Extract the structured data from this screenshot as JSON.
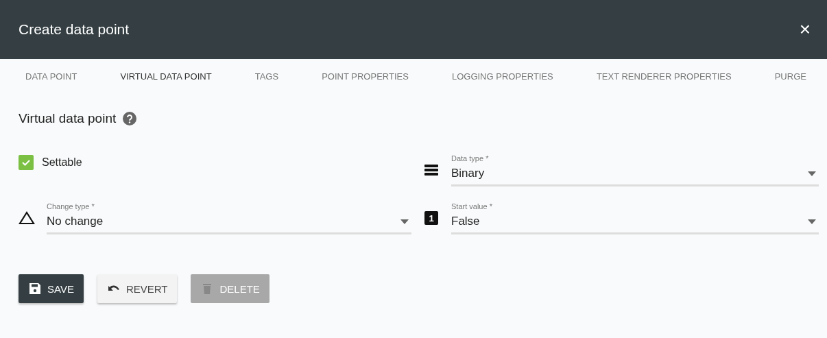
{
  "window": {
    "title": "Create data point",
    "close": "×"
  },
  "tabs": [
    {
      "label": "DATA POINT",
      "selected": false
    },
    {
      "label": "VIRTUAL DATA POINT",
      "selected": true
    },
    {
      "label": "TAGS",
      "selected": false
    },
    {
      "label": "POINT PROPERTIES",
      "selected": false
    },
    {
      "label": "LOGGING PROPERTIES",
      "selected": false
    },
    {
      "label": "TEXT RENDERER PROPERTIES",
      "selected": false
    },
    {
      "label": "PURGE",
      "selected": false
    }
  ],
  "section": {
    "title": "Virtual data point"
  },
  "settable": {
    "label": "Settable",
    "checked": true
  },
  "fields": [
    {
      "kind": "list",
      "label": "Data type *",
      "value": "Binary"
    },
    {
      "kind": "delta",
      "label": "Change type *",
      "value": "No change"
    },
    {
      "kind": "number",
      "icon_text": "1",
      "label": "Start value *",
      "value": "False"
    }
  ],
  "buttons": [
    {
      "kind": "save",
      "label": "SAVE",
      "disabled": false
    },
    {
      "kind": "revert",
      "label": "REVERT",
      "disabled": false
    },
    {
      "kind": "delete",
      "label": "DELETE",
      "disabled": true
    }
  ]
}
